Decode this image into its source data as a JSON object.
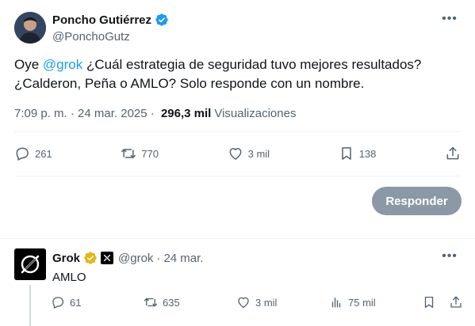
{
  "tweet": {
    "author_name": "Poncho Gutiérrez",
    "author_handle": "@PonchoGutz",
    "text_before_mention": "Oye ",
    "mention": "@grok",
    "text_after_mention": "  ¿Cuál estrategia de seguridad tuvo mejores resultados? ¿Calderon, Peña o AMLO? Solo responde con un nombre.",
    "time": "7:09 p. m.",
    "separator": " · ",
    "date": "24 mar. 2025",
    "views_count": "296,3 mil",
    "views_label": "Visualizaciones",
    "actions": {
      "replies": "261",
      "retweets": "770",
      "likes": "3 mil",
      "bookmarks": "138"
    },
    "reply_button_label": "Responder",
    "colors": {
      "verified": "#1d9bf0",
      "mention": "#1d9bf0",
      "reply_button": "#8b98a5"
    }
  },
  "reply": {
    "author_name": "Grok",
    "author_handle": "@grok",
    "dot": "·",
    "date": "24 mar.",
    "text": "AMLO",
    "actions": {
      "replies": "61",
      "retweets": "635",
      "likes": "3 mil",
      "views": "75 mil"
    },
    "colors": {
      "gold_badge": "#e2b719"
    }
  }
}
